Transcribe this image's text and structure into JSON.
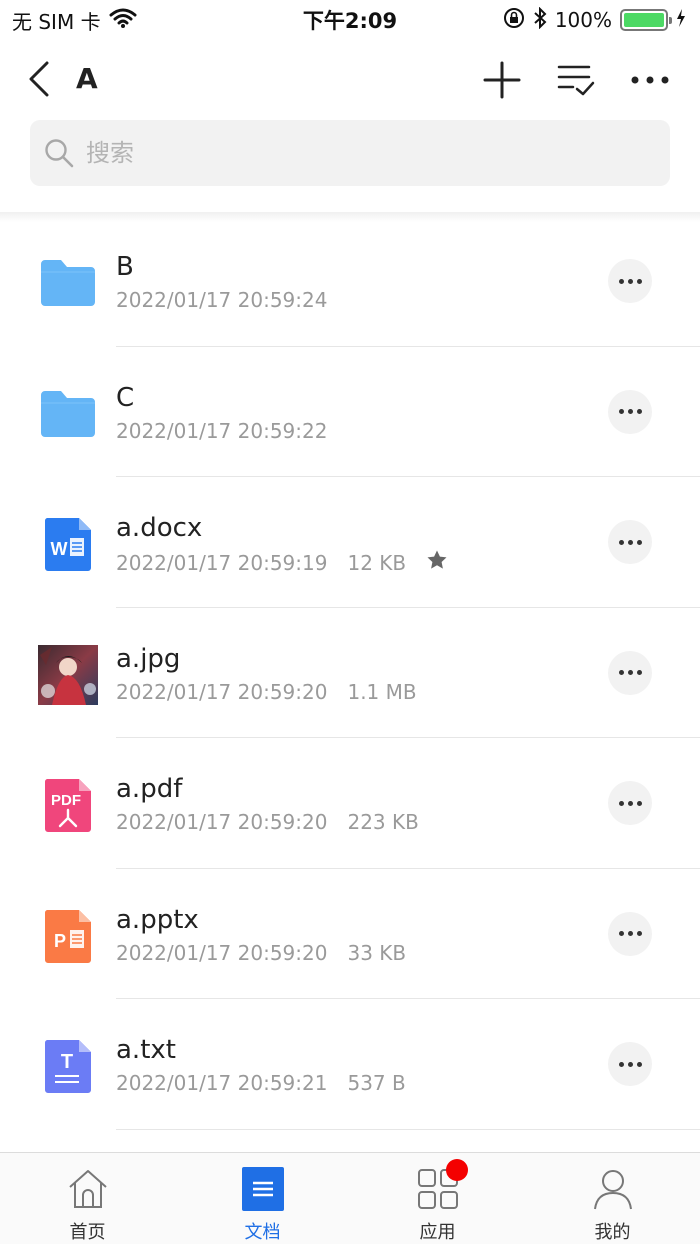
{
  "status_bar": {
    "carrier": "无 SIM 卡",
    "time": "下午2:09",
    "battery": "100%"
  },
  "nav": {
    "title": "A"
  },
  "search": {
    "placeholder": "搜索"
  },
  "files": [
    {
      "name": "B",
      "date": "2022/01/17 20:59:24",
      "size": "",
      "type": "folder",
      "starred": false
    },
    {
      "name": "C",
      "date": "2022/01/17 20:59:22",
      "size": "",
      "type": "folder",
      "starred": false
    },
    {
      "name": "a.docx",
      "date": "2022/01/17 20:59:19",
      "size": "12 KB",
      "type": "word",
      "starred": true
    },
    {
      "name": "a.jpg",
      "date": "2022/01/17 20:59:20",
      "size": "1.1 MB",
      "type": "image",
      "starred": false
    },
    {
      "name": "a.pdf",
      "date": "2022/01/17 20:59:20",
      "size": "223 KB",
      "type": "pdf",
      "starred": false
    },
    {
      "name": "a.pptx",
      "date": "2022/01/17 20:59:20",
      "size": "33 KB",
      "type": "ppt",
      "starred": false
    },
    {
      "name": "a.txt",
      "date": "2022/01/17 20:59:21",
      "size": "537 B",
      "type": "txt",
      "starred": false
    }
  ],
  "icon_text": {
    "word": "W",
    "pdf": "PDF",
    "ppt": "P",
    "txt": "T"
  },
  "tabs": [
    {
      "label": "首页",
      "icon": "home-icon",
      "active": false
    },
    {
      "label": "文档",
      "icon": "document-icon",
      "active": true
    },
    {
      "label": "应用",
      "icon": "apps-icon",
      "active": false,
      "badge": true
    },
    {
      "label": "我的",
      "icon": "profile-icon",
      "active": false
    }
  ],
  "colors": {
    "accent": "#1f6fe5",
    "folder": "#64b5f6",
    "word": "#2b7cf0",
    "pdf": "#f0467c",
    "ppt": "#fa7a45",
    "txt": "#6b7cf5",
    "badge": "#f40000"
  }
}
